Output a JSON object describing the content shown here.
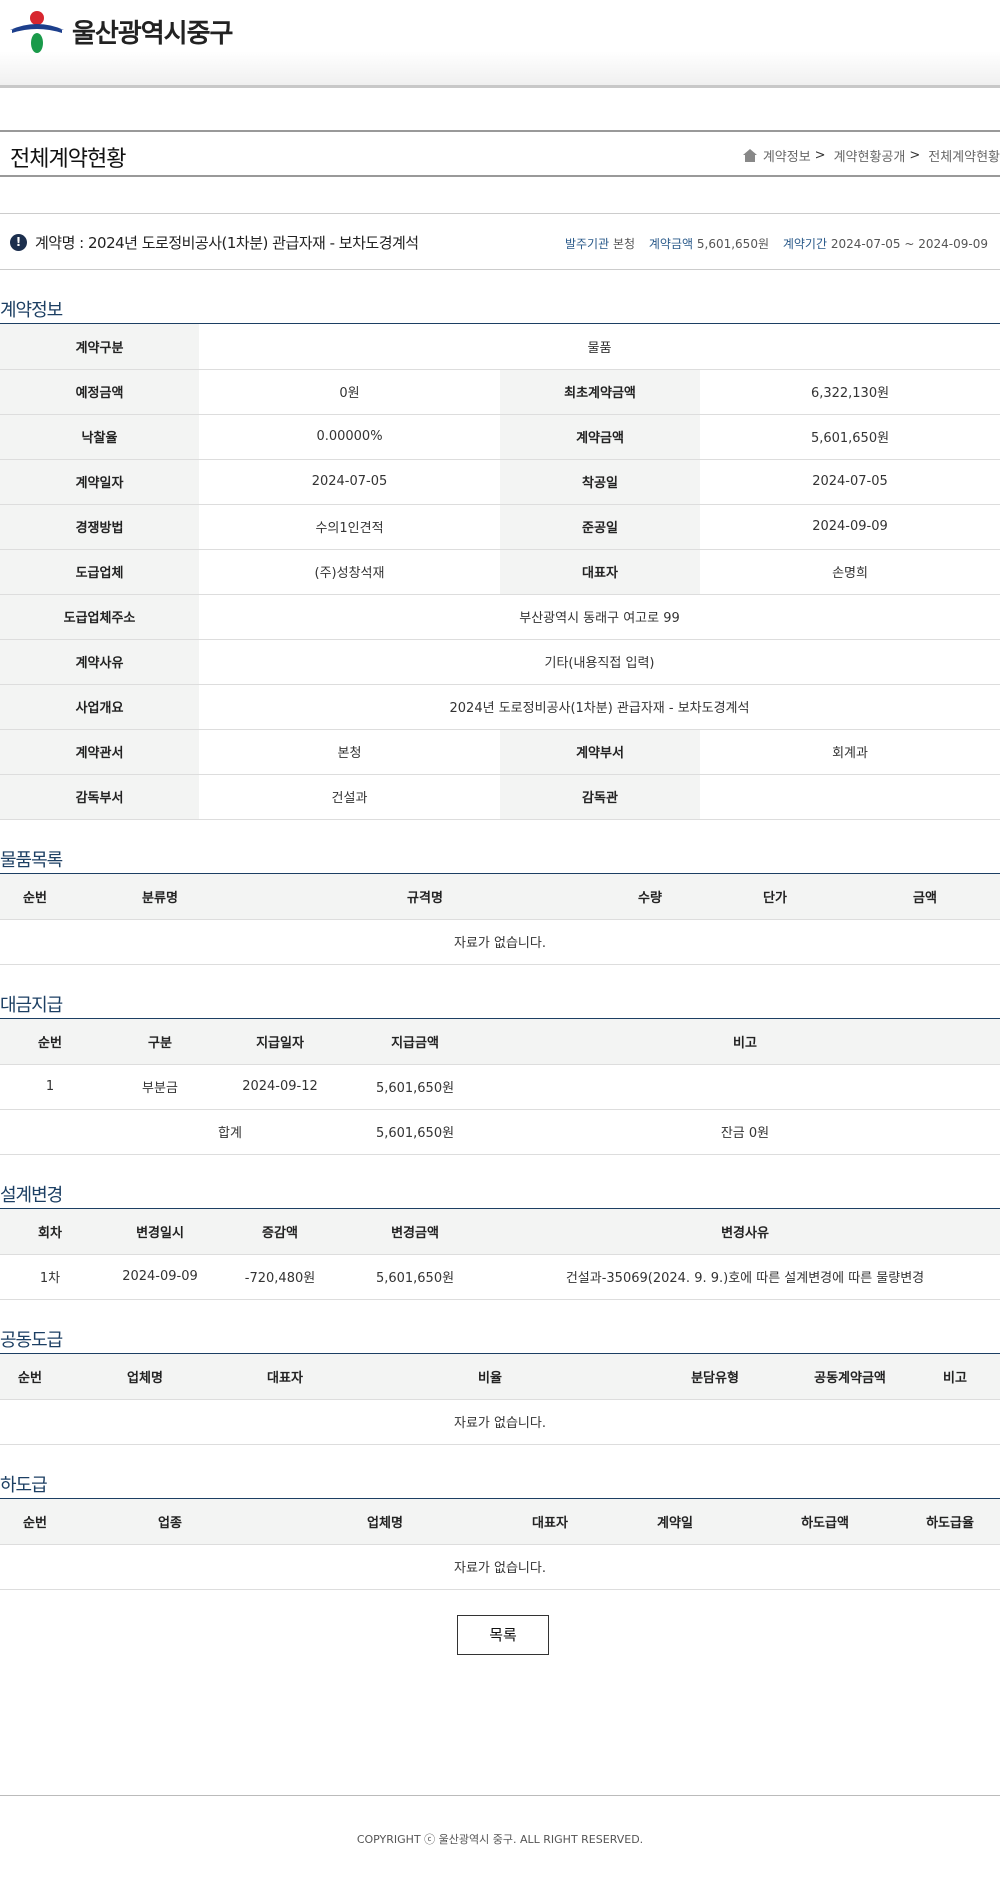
{
  "header": {
    "site_name": "울산광역시중구"
  },
  "page": {
    "title": "전체계약현황",
    "breadcrumb": [
      "계약정보",
      "계약현황공개",
      "전체계약현황"
    ]
  },
  "summary": {
    "contract_name": "계약명 : 2024년 도로정비공사(1차분) 관급자재 - 보차도경계석",
    "ordering_org_label": "발주기관",
    "ordering_org": "본청",
    "amount_label": "계약금액",
    "amount": "5,601,650원",
    "period_label": "계약기간",
    "period": "2024-07-05 ~ 2024-09-09"
  },
  "contract_info": {
    "section_title": "계약정보",
    "type_label": "계약구분",
    "type": "물품",
    "estimated_label": "예정금액",
    "estimated": "0원",
    "initial_label": "최초계약금액",
    "initial": "6,322,130원",
    "rate_label": "낙찰율",
    "rate": "0.00000%",
    "amount_label": "계약금액",
    "amount": "5,601,650원",
    "date_label": "계약일자",
    "date": "2024-07-05",
    "start_label": "착공일",
    "start": "2024-07-05",
    "method_label": "경쟁방법",
    "method": "수의1인견적",
    "end_label": "준공일",
    "end": "2024-09-09",
    "contractor_label": "도급업체",
    "contractor": "(주)성창석재",
    "ceo_label": "대표자",
    "ceo": "손명희",
    "address_label": "도급업체주소",
    "address": "부산광역시 동래구 여고로 99",
    "reason_label": "계약사유",
    "reason": "기타(내용직접 입력)",
    "overview_label": "사업개요",
    "overview": "2024년 도로정비공사(1차분) 관급자재 - 보차도경계석",
    "office_label": "계약관서",
    "office": "본청",
    "dept_label": "계약부서",
    "dept": "회계과",
    "supervise_dept_label": "감독부서",
    "supervise_dept": "건설과",
    "supervisor_label": "감독관",
    "supervisor": ""
  },
  "goods": {
    "section_title": "물품목록",
    "headers": [
      "순번",
      "분류명",
      "규격명",
      "수량",
      "단가",
      "금액"
    ],
    "empty": "자료가 없습니다."
  },
  "payment": {
    "section_title": "대금지급",
    "headers": [
      "순번",
      "구분",
      "지급일자",
      "지급금액",
      "비고"
    ],
    "rows": [
      [
        "1",
        "부분금",
        "2024-09-12",
        "5,601,650원",
        ""
      ]
    ],
    "total_label": "합계",
    "total_amount": "5,601,650원",
    "total_note": "잔금 0원"
  },
  "design_change": {
    "section_title": "설계변경",
    "headers": [
      "회차",
      "변경일시",
      "증감액",
      "변경금액",
      "변경사유"
    ],
    "rows": [
      [
        "1차",
        "2024-09-09",
        "-720,480원",
        "5,601,650원",
        "건설과-35069(2024. 9. 9.)호에 따른 설계변경에 따른 물량변경"
      ]
    ]
  },
  "joint": {
    "section_title": "공동도급",
    "headers": [
      "순번",
      "업체명",
      "대표자",
      "비율",
      "분담유형",
      "공동계약금액",
      "비고"
    ],
    "empty": "자료가 없습니다."
  },
  "subcontract": {
    "section_title": "하도급",
    "headers": [
      "순번",
      "업종",
      "업체명",
      "대표자",
      "계약일",
      "하도급액",
      "하도급율"
    ],
    "empty": "자료가 없습니다."
  },
  "list_button": "목록",
  "footer": {
    "copyright": "COPYRIGHT ⓒ 울산광역시 중구. ALL RIGHT RESERVED."
  }
}
